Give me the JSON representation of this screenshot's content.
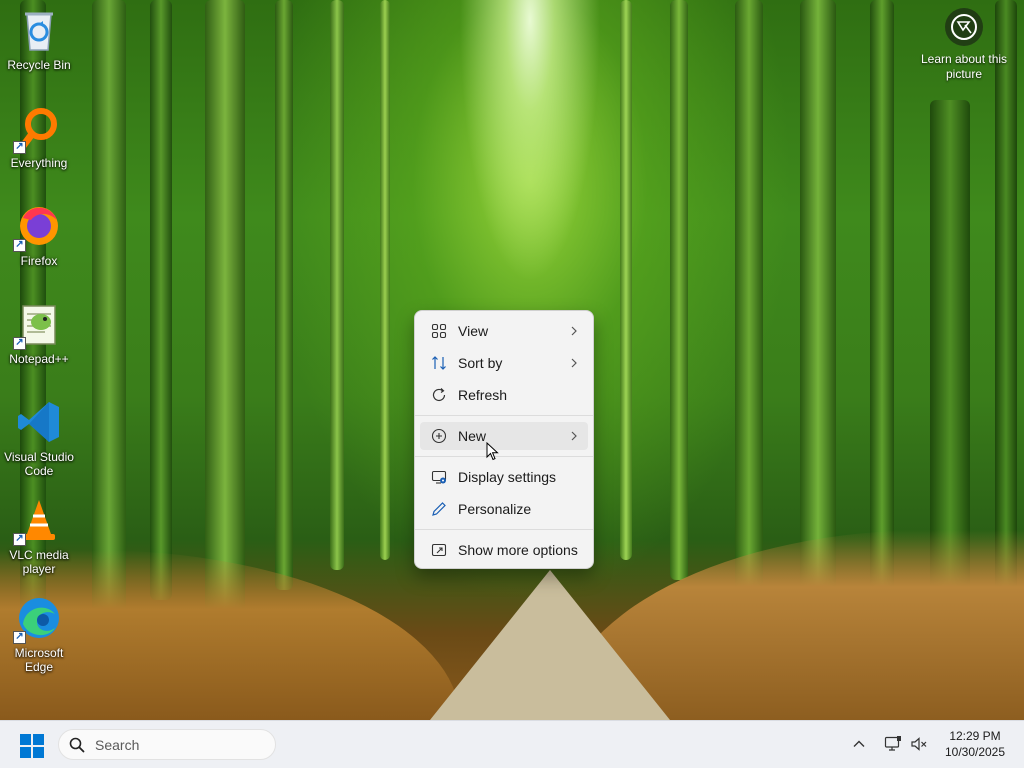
{
  "desktop": {
    "icons": [
      {
        "label": "Recycle Bin"
      },
      {
        "label": "Everything"
      },
      {
        "label": "Firefox"
      },
      {
        "label": "Notepad++"
      },
      {
        "label": "Visual Studio Code"
      },
      {
        "label": "VLC media player"
      },
      {
        "label": "Microsoft Edge"
      }
    ],
    "learn_label": "Learn about this picture"
  },
  "context_menu": {
    "items": [
      {
        "label": "View",
        "icon": "grid-icon",
        "has_submenu": true
      },
      {
        "label": "Sort by",
        "icon": "sort-icon",
        "has_submenu": true
      },
      {
        "label": "Refresh",
        "icon": "refresh-icon",
        "has_submenu": false
      },
      {
        "label": "New",
        "icon": "plus-circle-icon",
        "has_submenu": true,
        "hovered": true
      },
      {
        "label": "Display settings",
        "icon": "display-settings-icon",
        "has_submenu": false
      },
      {
        "label": "Personalize",
        "icon": "pen-icon",
        "has_submenu": false
      },
      {
        "label": "Show more options",
        "icon": "expand-icon",
        "has_submenu": false
      }
    ]
  },
  "taskbar": {
    "search_placeholder": "Search",
    "time": "12:29 PM",
    "date": "10/30/2025"
  },
  "colors": {
    "accent": "#0067c0",
    "menu_bg": "#f3f3f3",
    "taskbar_bg": "#eef0f4"
  }
}
